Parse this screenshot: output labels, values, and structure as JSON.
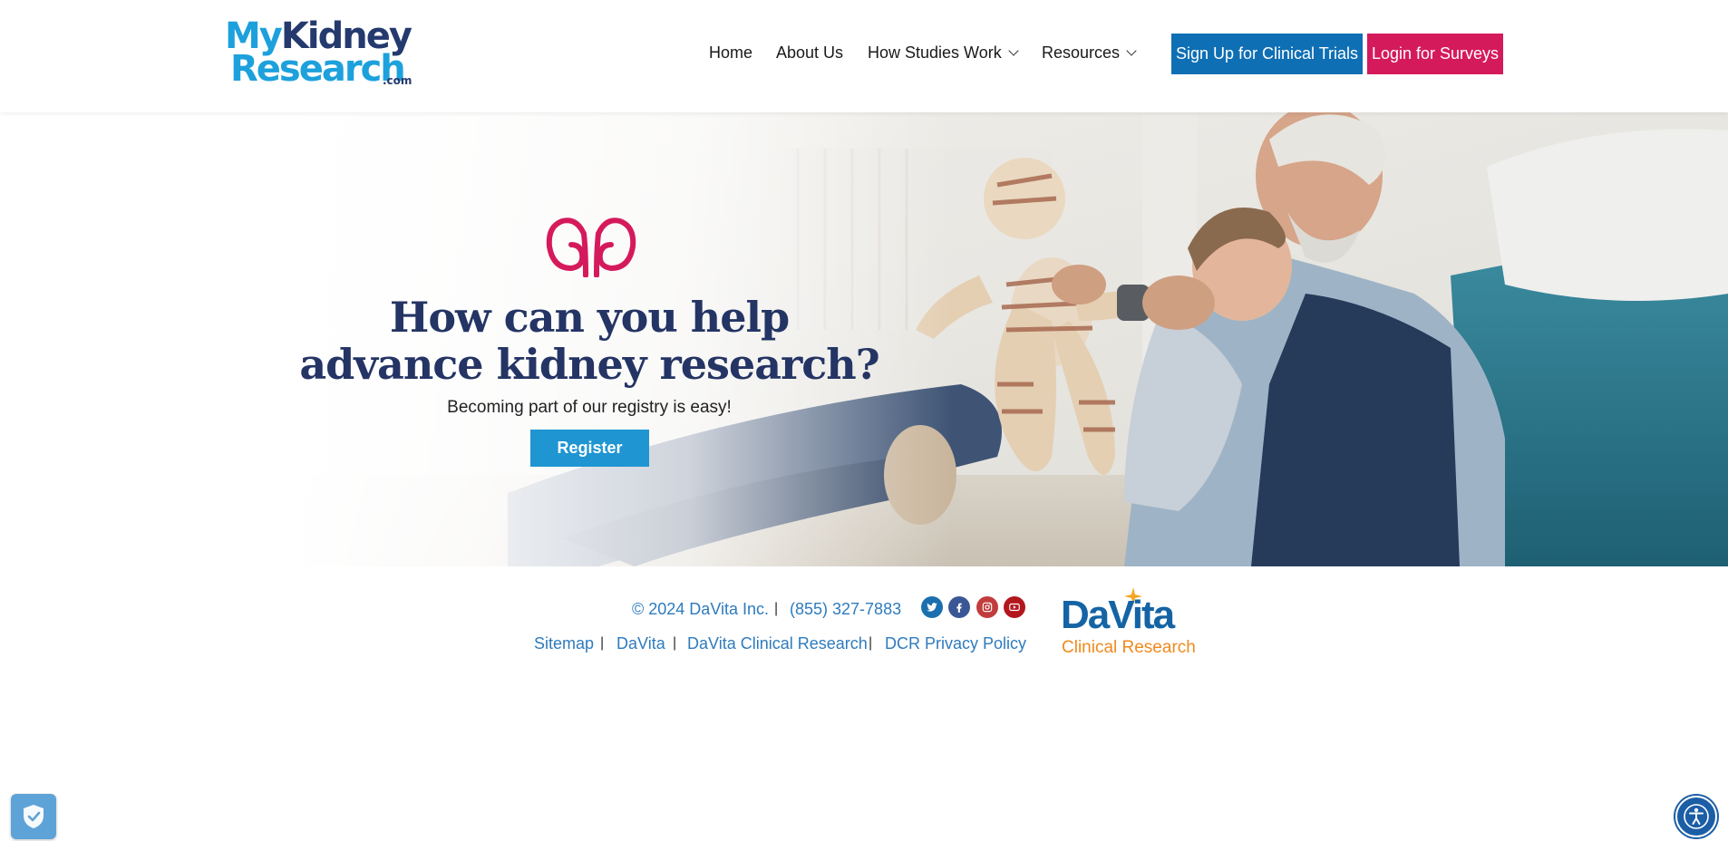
{
  "header": {
    "logo": {
      "line1_a": "My",
      "line1_b": "Kidney",
      "line2": "Research",
      "suffix": ".com"
    },
    "nav": [
      {
        "label": "Home"
      },
      {
        "label": "About Us"
      },
      {
        "label": "How Studies Work",
        "has_dropdown": true
      },
      {
        "label": "Resources",
        "has_dropdown": true
      }
    ],
    "signup_label": "Sign Up for Clinical Trials",
    "login_label": "Login for Surveys"
  },
  "hero": {
    "icon": "kidneys-icon",
    "title": "How can you help advance kidney research?",
    "subtitle": "Becoming part of our registry is easy!",
    "register_label": "Register"
  },
  "footer": {
    "copyright": "© 2024 DaVita Inc.",
    "phone": "(855) 327-7883",
    "separator": "|",
    "social": [
      {
        "icon": "twitter-icon",
        "color": "#1b6fae"
      },
      {
        "icon": "facebook-icon",
        "color": "#3a5795"
      },
      {
        "icon": "instagram-icon",
        "color": "#c13d3d"
      },
      {
        "icon": "youtube-icon",
        "color": "#b3161d"
      }
    ],
    "links": [
      {
        "label": "Sitemap"
      },
      {
        "label": "DaVita"
      },
      {
        "label": "DaVita Clinical Research"
      },
      {
        "label": "DCR Privacy Policy"
      }
    ],
    "partner_logo": {
      "word": "DaVita",
      "subtitle": "Clinical Research"
    }
  },
  "widgets": {
    "privacy": "shield-check-icon",
    "accessibility": "accessibility-icon"
  },
  "colors": {
    "brand_blue": "#1da1dc",
    "brand_navy": "#243464",
    "signup_bg": "#0f6fb4",
    "login_bg": "#d51a5c",
    "register_bg": "#1f95d2",
    "link_blue": "#2e7bbd",
    "davita_orange": "#f08a1c"
  }
}
